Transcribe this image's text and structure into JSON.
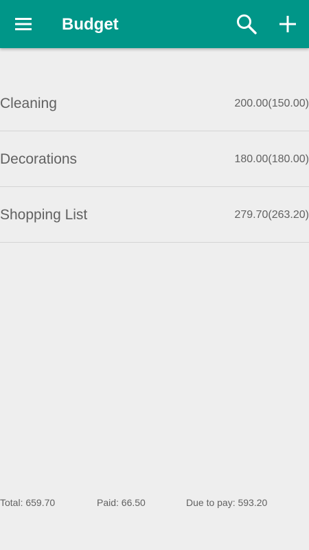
{
  "app_bar": {
    "title": "Budget",
    "background_color": "#009688",
    "menu_icon": "hamburger-menu-icon",
    "search_icon": "search-icon",
    "add_icon": "plus-icon"
  },
  "items": [
    {
      "name": "Cleaning",
      "amount": "200.00(150.00)"
    },
    {
      "name": "Decorations",
      "amount": "180.00(180.00)"
    },
    {
      "name": "Shopping List",
      "amount": "279.70(263.20)"
    }
  ],
  "footer": {
    "total": "Total: 659.70",
    "paid": "Paid: 66.50",
    "due": "Due to pay: 593.20"
  }
}
